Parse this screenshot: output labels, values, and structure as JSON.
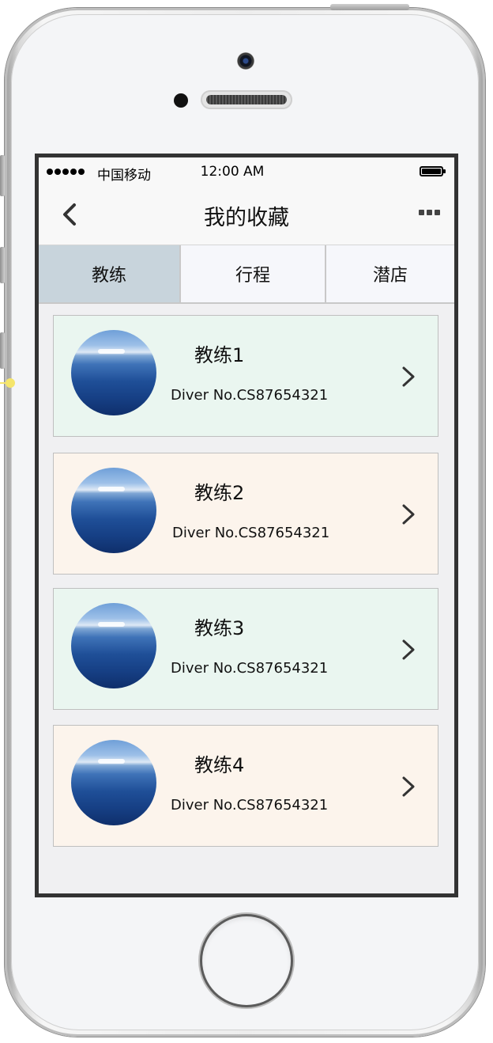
{
  "status_bar": {
    "carrier": "中国移动",
    "time": "12:00 AM"
  },
  "nav": {
    "title": "我的收藏"
  },
  "tabs": [
    {
      "label": "教练",
      "active": true
    },
    {
      "label": "行程",
      "active": false
    },
    {
      "label": "潜店",
      "active": false
    }
  ],
  "coaches": [
    {
      "name": "教练1",
      "diver_no": "Diver No.CS87654321",
      "bg": "#eaf6f0"
    },
    {
      "name": "教练2",
      "diver_no": "Diver No.CS87654321",
      "bg": "#fcf4ec"
    },
    {
      "name": "教练3",
      "diver_no": "Diver No.CS87654321",
      "bg": "#eaf6f0"
    },
    {
      "name": "教练4",
      "diver_no": "Diver No.CS87654321",
      "bg": "#fcf4ec"
    }
  ],
  "colors": {
    "active_tab": "#c8d4dc",
    "card_green": "#eaf6f0",
    "card_peach": "#fcf4ec"
  }
}
